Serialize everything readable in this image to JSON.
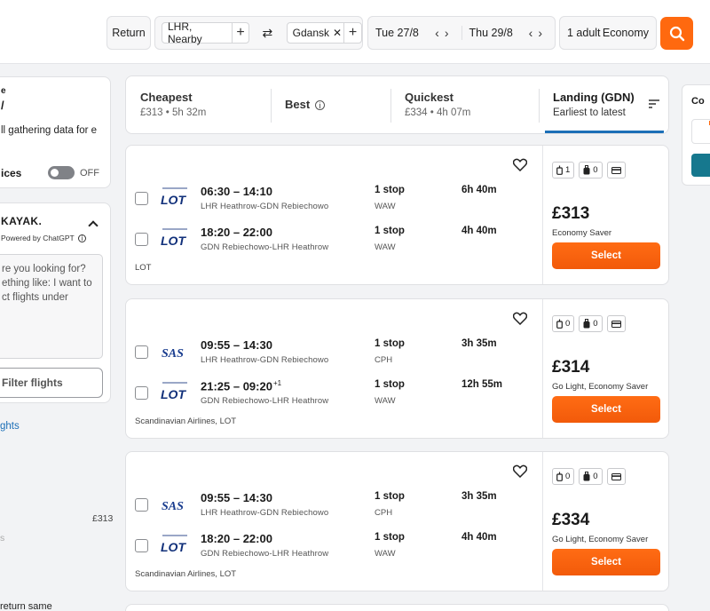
{
  "search": {
    "trip_type": "Return",
    "origin": "LHR, Nearby",
    "destination": "Gdansk",
    "depart_date": "Tue 27/8",
    "return_date": "Thu 29/8",
    "travellers": "1 adult",
    "cabin": "Economy",
    "icons": {
      "add": "plus-icon",
      "swap": "swap-arrows-icon",
      "clear": "close-icon",
      "search": "search-icon"
    }
  },
  "sidebar": {
    "card1": {
      "heading_fragment": "e",
      "title_fragment": "/",
      "note": "ll gathering data for e",
      "prices_label": "ices",
      "toggle_state": "OFF"
    },
    "ai": {
      "brand": "KAYAK.",
      "powered": "Powered by ChatGPT",
      "prompt": "re you looking for? ething like: I want to ct flights under",
      "button": "Filter flights"
    },
    "link": "ghts",
    "price": "£313",
    "faded": "s",
    "bottom": "return same"
  },
  "sort": {
    "tabs": [
      {
        "label": "Cheapest",
        "sub": "£313 • 5h 32m"
      },
      {
        "label": "Best",
        "sub": ""
      },
      {
        "label": "Quickest",
        "sub": "£334 • 4h 07m"
      },
      {
        "label": "Landing (GDN)",
        "sub": "Earliest to latest"
      }
    ],
    "active": "Landing (GDN)",
    "accent": "#1c6fb7"
  },
  "results": [
    {
      "legs": [
        {
          "logo": "LOT",
          "times": "06:30 – 14:10",
          "plus_day": "",
          "route": "LHR Heathrow-GDN Rebiechowo",
          "stops": "1 stop",
          "via": "WAW",
          "duration": "6h 40m"
        },
        {
          "logo": "LOT",
          "times": "18:20 – 22:00",
          "plus_day": "",
          "route": "GDN Rebiechowo-LHR Heathrow",
          "stops": "1 stop",
          "via": "WAW",
          "duration": "4h 40m"
        }
      ],
      "airline": "LOT",
      "bags": {
        "personal": "1",
        "carry_on": "0"
      },
      "price": "£313",
      "fare": "Economy Saver",
      "select": "Select"
    },
    {
      "legs": [
        {
          "logo": "SAS",
          "times": "09:55 – 14:30",
          "plus_day": "",
          "route": "LHR Heathrow-GDN Rebiechowo",
          "stops": "1 stop",
          "via": "CPH",
          "duration": "3h 35m"
        },
        {
          "logo": "LOT",
          "times": "21:25 – 09:20",
          "plus_day": "+1",
          "route": "GDN Rebiechowo-LHR Heathrow",
          "stops": "1 stop",
          "via": "WAW",
          "duration": "12h 55m"
        }
      ],
      "airline": "Scandinavian Airlines, LOT",
      "bags": {
        "personal": "0",
        "carry_on": "0"
      },
      "price": "£314",
      "fare": "Go Light, Economy Saver",
      "select": "Select"
    },
    {
      "legs": [
        {
          "logo": "SAS",
          "times": "09:55 – 14:30",
          "plus_day": "",
          "route": "LHR Heathrow-GDN Rebiechowo",
          "stops": "1 stop",
          "via": "CPH",
          "duration": "3h 35m"
        },
        {
          "logo": "LOT",
          "times": "18:20 – 22:00",
          "plus_day": "",
          "route": "GDN Rebiechowo-LHR Heathrow",
          "stops": "1 stop",
          "via": "WAW",
          "duration": "4h 40m"
        }
      ],
      "airline": "Scandinavian Airlines, LOT",
      "bags": {
        "personal": "0",
        "carry_on": "0"
      },
      "price": "£334",
      "fare": "Go Light, Economy Saver",
      "select": "Select"
    }
  ],
  "right_panel": {
    "title_fragment": "Co"
  },
  "colors": {
    "brand_orange": "#ff690f",
    "lot_blue": "#11307a",
    "sas_blue": "#1a3d8f",
    "teal": "#16788e"
  }
}
